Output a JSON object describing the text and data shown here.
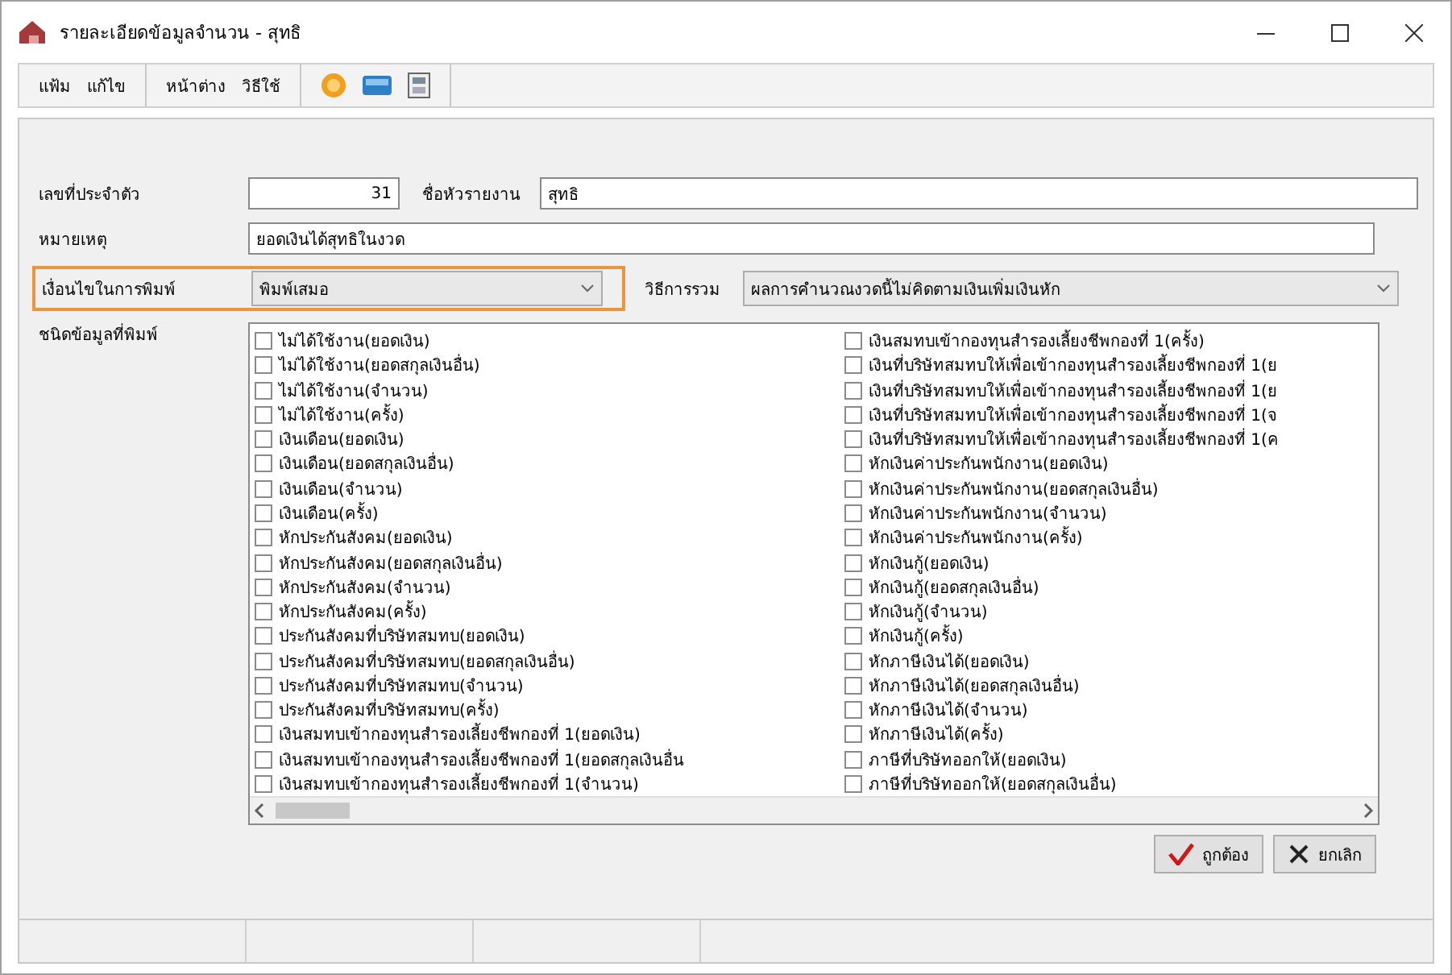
{
  "window": {
    "title": "รายละเอียดข้อมูลจำนวน - สุทธิ"
  },
  "menu_groups": [
    [
      "แฟ้ม",
      "แก้ไข"
    ],
    [
      "หน้าต่าง",
      "วิธีใช้"
    ]
  ],
  "form": {
    "id_label": "เลขที่ประจำตัว",
    "id_value": "31",
    "report_name_label": "ชื่อหัวรายงาน",
    "report_name_value": "สุทธิ",
    "note_label": "หมายเหตุ",
    "note_value": "ยอดเงินได้สุทธิในงวด",
    "print_condition": {
      "label": "เงื่อนไขในการพิมพ์",
      "value": "พิมพ์เสมอ",
      "highlighted": true
    },
    "sum_method": {
      "label": "วิธีการรวม",
      "value": "ผลการคำนวณงวดนี้ไม่คิดตามเงินเพิ่มเงินหัก"
    }
  },
  "data_types": {
    "label": "ชนิดข้อมูลที่พิมพ์",
    "columns": [
      [
        {
          "text": "ไม่ได้ใช้งาน(ยอดเงิน)",
          "checked": false
        },
        {
          "text": "ไม่ได้ใช้งาน(ยอดสกุลเงินอื่น)",
          "checked": false
        },
        {
          "text": "ไม่ได้ใช้งาน(จำนวน)",
          "checked": false
        },
        {
          "text": "ไม่ได้ใช้งาน(ครั้ง)",
          "checked": false
        },
        {
          "text": "เงินเดือน(ยอดเงิน)",
          "checked": false
        },
        {
          "text": "เงินเดือน(ยอดสกุลเงินอื่น)",
          "checked": false
        },
        {
          "text": "เงินเดือน(จำนวน)",
          "checked": false
        },
        {
          "text": "เงินเดือน(ครั้ง)",
          "checked": false
        },
        {
          "text": "หักประกันสังคม(ยอดเงิน)",
          "checked": false
        },
        {
          "text": "หักประกันสังคม(ยอดสกุลเงินอื่น)",
          "checked": false
        },
        {
          "text": "หักประกันสังคม(จำนวน)",
          "checked": false
        },
        {
          "text": "หักประกันสังคม(ครั้ง)",
          "checked": false
        },
        {
          "text": "ประกันสังคมที่บริษัทสมทบ(ยอดเงิน)",
          "checked": false
        },
        {
          "text": "ประกันสังคมที่บริษัทสมทบ(ยอดสกุลเงินอื่น)",
          "checked": false
        },
        {
          "text": "ประกันสังคมที่บริษัทสมทบ(จำนวน)",
          "checked": false
        },
        {
          "text": "ประกันสังคมที่บริษัทสมทบ(ครั้ง)",
          "checked": false
        },
        {
          "text": "เงินสมทบเข้ากองทุนสำรองเลี้ยงชีพกองที่ 1(ยอดเงิน)",
          "checked": false
        },
        {
          "text": "เงินสมทบเข้ากองทุนสำรองเลี้ยงชีพกองที่ 1(ยอดสกุลเงินอื่น",
          "checked": false
        },
        {
          "text": "เงินสมทบเข้ากองทุนสำรองเลี้ยงชีพกองที่ 1(จำนวน)",
          "checked": false
        }
      ],
      [
        {
          "text": "เงินสมทบเข้ากองทุนสำรองเลี้ยงชีพกองที่ 1(ครั้ง)",
          "checked": false
        },
        {
          "text": "เงินที่บริษัทสมทบให้เพื่อเข้ากองทุนสำรองเลี้ยงชีพกองที่ 1(ย",
          "checked": false
        },
        {
          "text": "เงินที่บริษัทสมทบให้เพื่อเข้ากองทุนสำรองเลี้ยงชีพกองที่ 1(ย",
          "checked": false
        },
        {
          "text": "เงินที่บริษัทสมทบให้เพื่อเข้ากองทุนสำรองเลี้ยงชีพกองที่ 1(จ",
          "checked": false
        },
        {
          "text": "เงินที่บริษัทสมทบให้เพื่อเข้ากองทุนสำรองเลี้ยงชีพกองที่ 1(ค",
          "checked": false
        },
        {
          "text": "หักเงินค่าประกันพนักงาน(ยอดเงิน)",
          "checked": false
        },
        {
          "text": "หักเงินค่าประกันพนักงาน(ยอดสกุลเงินอื่น)",
          "checked": false
        },
        {
          "text": "หักเงินค่าประกันพนักงาน(จำนวน)",
          "checked": false
        },
        {
          "text": "หักเงินค่าประกันพนักงาน(ครั้ง)",
          "checked": false
        },
        {
          "text": "หักเงินกู้(ยอดเงิน)",
          "checked": false
        },
        {
          "text": "หักเงินกู้(ยอดสกุลเงินอื่น)",
          "checked": false
        },
        {
          "text": "หักเงินกู้(จำนวน)",
          "checked": false
        },
        {
          "text": "หักเงินกู้(ครั้ง)",
          "checked": false
        },
        {
          "text": "หักภาษีเงินได้(ยอดเงิน)",
          "checked": false
        },
        {
          "text": "หักภาษีเงินได้(ยอดสกุลเงินอื่น)",
          "checked": false
        },
        {
          "text": "หักภาษีเงินได้(จำนวน)",
          "checked": false
        },
        {
          "text": "หักภาษีเงินได้(ครั้ง)",
          "checked": false
        },
        {
          "text": "ภาษีที่บริษัทออกให้(ยอดเงิน)",
          "checked": false
        },
        {
          "text": "ภาษีที่บริษัทออกให้(ยอดสกุลเงินอื่น)",
          "checked": false
        }
      ]
    ]
  },
  "buttons": [
    {
      "kind": "ok",
      "label": "ถูกต้อง"
    },
    {
      "kind": "cancel",
      "label": "ยกเลิก"
    }
  ]
}
